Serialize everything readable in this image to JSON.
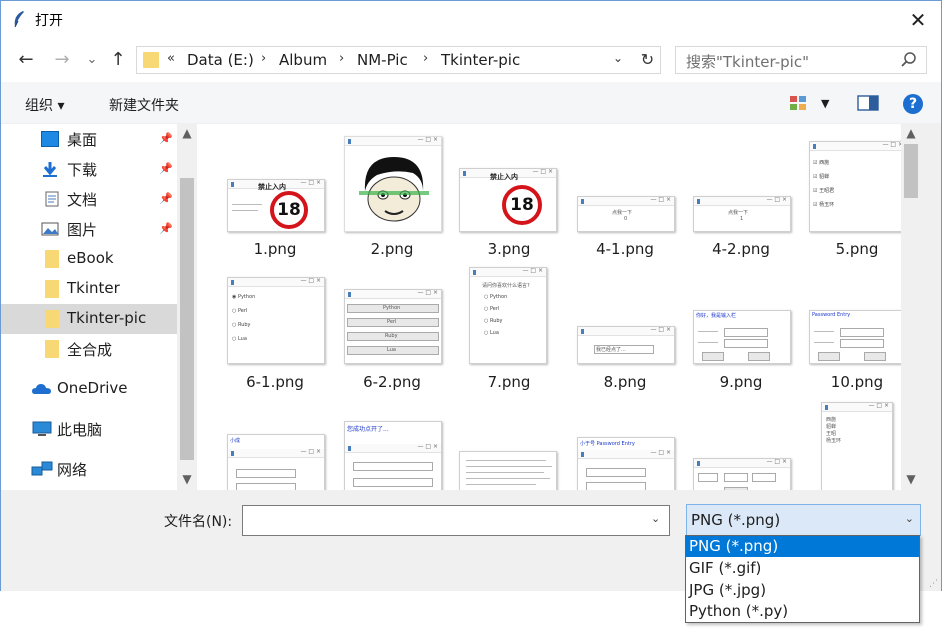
{
  "window": {
    "title": "打开"
  },
  "nav": {
    "back": "←",
    "forward": "→",
    "recent": "⌄",
    "up": "↑",
    "breadcrumb_prefix": "«",
    "breadcrumb": [
      "Data (E:)",
      "Album",
      "NM-Pic",
      "Tkinter-pic"
    ],
    "refresh": "↻"
  },
  "search": {
    "placeholder": "搜索\"Tkinter-pic\""
  },
  "toolbar": {
    "organize": "组织 ▾",
    "new_folder": "新建文件夹",
    "help": "?"
  },
  "sidebar": {
    "items": [
      {
        "label": "桌面",
        "icon": "desktop-icon",
        "pinned": true
      },
      {
        "label": "下载",
        "icon": "download-icon",
        "pinned": true
      },
      {
        "label": "文档",
        "icon": "document-icon",
        "pinned": true
      },
      {
        "label": "图片",
        "icon": "picture-icon",
        "pinned": true
      },
      {
        "label": "eBook",
        "icon": "folder-icon",
        "pinned": false
      },
      {
        "label": "Tkinter",
        "icon": "folder-icon",
        "pinned": false
      },
      {
        "label": "Tkinter-pic",
        "icon": "folder-icon",
        "pinned": false,
        "selected": true
      },
      {
        "label": "全合成",
        "icon": "folder-icon",
        "pinned": false
      },
      {
        "label": "OneDrive",
        "icon": "onedrive-icon",
        "pinned": false
      },
      {
        "label": "此电脑",
        "icon": "computer-icon",
        "pinned": false
      },
      {
        "label": "网络",
        "icon": "network-icon",
        "pinned": false
      }
    ]
  },
  "files": [
    {
      "name": "1.png"
    },
    {
      "name": "2.png"
    },
    {
      "name": "3.png"
    },
    {
      "name": "4-1.png"
    },
    {
      "name": "4-2.png"
    },
    {
      "name": "5.png"
    },
    {
      "name": "6-1.png"
    },
    {
      "name": "6-2.png"
    },
    {
      "name": "7.png"
    },
    {
      "name": "8.png"
    },
    {
      "name": "9.png"
    },
    {
      "name": "10.png"
    }
  ],
  "thumb_text": {
    "forbidden": "禁止入内",
    "eighteen": "18",
    "click_me": "点我一下",
    "checks": [
      "西施",
      "貂蝉",
      "王昭君",
      "杨玉环"
    ],
    "langs": [
      "Python",
      "Perl",
      "Ruby",
      "Lua"
    ],
    "pick_lang": "请问你喜欢什么语言?",
    "already_clicked": "我已经点了...",
    "hello_blue": "你好，我是输入栏",
    "password_blue": "Password Entry",
    "clicked_title": "您成功点开了..."
  },
  "bottom": {
    "filename_label": "文件名(N):",
    "filename_value": "",
    "filetype_value": "PNG (*.png)",
    "filetype_options": [
      "PNG (*.png)",
      "GIF (*.gif)",
      "JPG (*.jpg)",
      "Python (*.py)"
    ]
  },
  "colors": {
    "selection": "#0078d7",
    "sidebar_selected": "#cce8ff",
    "folder": "#f8d775"
  }
}
